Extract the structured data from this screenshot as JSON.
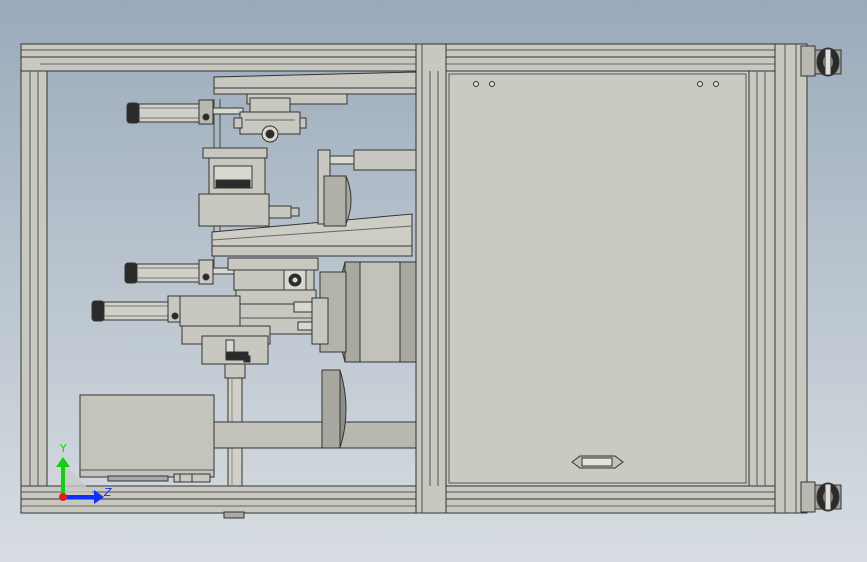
{
  "viewport": {
    "background_top": "#9aaabb",
    "background_bottom": "#d7dde2",
    "part_fill": "#c8c8c0",
    "panel_fill": "#cacac3",
    "edge_color": "#333333",
    "dark_fill": "#2a2a2a"
  },
  "triad": {
    "y_label": "Y",
    "z_label": "Z",
    "x_color": "#e02020",
    "y_color": "#10d010",
    "z_color": "#1030ff"
  }
}
